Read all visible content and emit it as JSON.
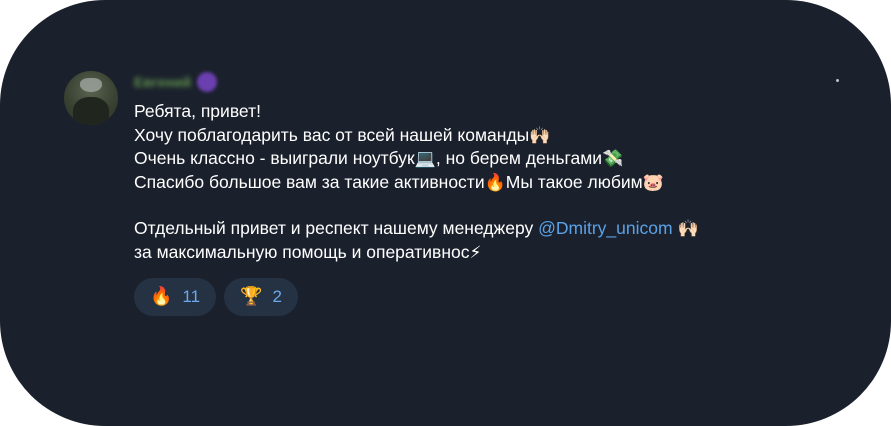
{
  "sender": {
    "name": "Евгений",
    "name_color": "#5f8f4e",
    "badge_icon": "premium-star-icon"
  },
  "message": {
    "lines": [
      {
        "text": "Ребята, привет!"
      },
      {
        "text": "Хочу поблагодарить вас от всей нашей команды",
        "emoji": "🙌🏻"
      },
      {
        "text_a": "Очень классно - выиграли ноутбук",
        "emoji_a": "💻",
        "text_b": ", но берем деньгами",
        "emoji_b": "💸"
      },
      {
        "text_a": "Спасибо большое вам за такие активности",
        "emoji_a": "🔥",
        "text_b": "Мы такое любим",
        "emoji_b": "🐷"
      },
      {
        "text_a": "Отдельный привет и респект нашему менеджеру ",
        "mention": "@Dmitry_unicom",
        "emoji": "🙌🏻"
      },
      {
        "text": "за максимальную помощь и оперативнос",
        "emoji": "⚡"
      }
    ]
  },
  "reactions": [
    {
      "emoji": "🔥",
      "count": "11"
    },
    {
      "emoji": "🏆",
      "count": "2"
    }
  ],
  "colors": {
    "background": "#1b212c",
    "mention": "#5aa2e8",
    "reaction_bg": "#243243",
    "reaction_count": "#6aa9ee"
  }
}
